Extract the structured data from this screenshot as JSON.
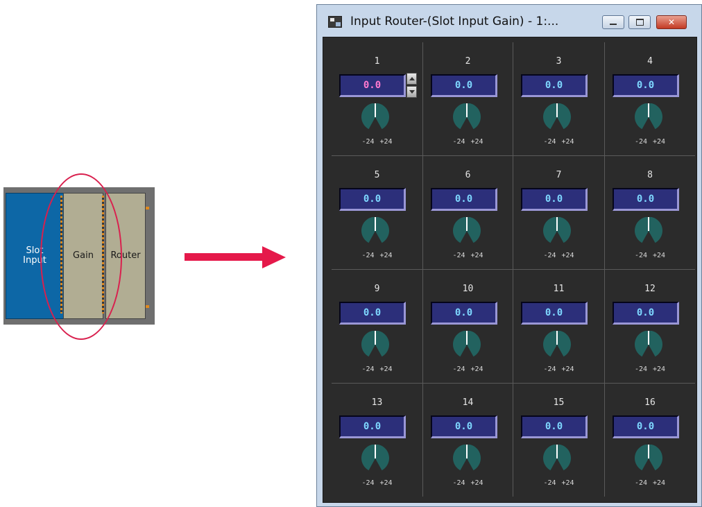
{
  "diagram": {
    "blocks": [
      {
        "label": "Slot\nInput"
      },
      {
        "label": "Gain"
      },
      {
        "label": "Router"
      }
    ],
    "colors": {
      "highlight": "#d9204e",
      "arrow": "#e5194a"
    }
  },
  "window": {
    "title": "Input Router-(Slot Input Gain) - 1:...",
    "buttons": {
      "minimize": "minimize-icon",
      "maximize": "maximize-icon",
      "close": "close-icon"
    },
    "close_glyph": "✕",
    "knob_range": {
      "min": "-24",
      "max": "+24"
    },
    "channels": [
      {
        "number": "1",
        "value": "0.0",
        "active": true
      },
      {
        "number": "2",
        "value": "0.0"
      },
      {
        "number": "3",
        "value": "0.0"
      },
      {
        "number": "4",
        "value": "0.0"
      },
      {
        "number": "5",
        "value": "0.0"
      },
      {
        "number": "6",
        "value": "0.0"
      },
      {
        "number": "7",
        "value": "0.0"
      },
      {
        "number": "8",
        "value": "0.0"
      },
      {
        "number": "9",
        "value": "0.0"
      },
      {
        "number": "10",
        "value": "0.0"
      },
      {
        "number": "11",
        "value": "0.0"
      },
      {
        "number": "12",
        "value": "0.0"
      },
      {
        "number": "13",
        "value": "0.0"
      },
      {
        "number": "14",
        "value": "0.0"
      },
      {
        "number": "15",
        "value": "0.0"
      },
      {
        "number": "16",
        "value": "0.0"
      }
    ],
    "colors": {
      "knob": "#22625f",
      "value_text": "#7ed7ff",
      "active_value_text": "#ff7ad0",
      "box": "#2c2f7a"
    }
  }
}
